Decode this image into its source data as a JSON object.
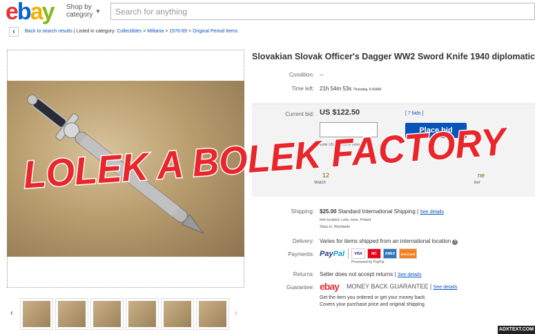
{
  "header": {
    "logo": {
      "e": "e",
      "b": "b",
      "a": "a",
      "y": "y"
    },
    "shop_by": "Shop by",
    "category": "category",
    "search_placeholder": "Search for anything"
  },
  "breadcrumb": {
    "back": "Back to search results",
    "listed": "| Listed in category:",
    "items": [
      "Collectibles",
      "Militaria",
      "1976-89",
      "Original Period Items"
    ],
    "sep": ">"
  },
  "listing": {
    "title": "Slovakian Slovak Officer's Dagger WW2 Sword Knife 1940 diplomatic",
    "condition_label": "Condition:",
    "condition_value": "--",
    "time_left_label": "Time left:",
    "time_left_value": "21h 54m 53s",
    "time_left_date": "Thursday, 6:43AM",
    "current_bid_label": "Current bid:",
    "current_bid_value": "US $122.50",
    "bids": "[ 7 bids ]",
    "place_bid": "Place bid",
    "bid_hint": "Enter US $125.00 or more",
    "hidden_left": "12",
    "hidden_watch": "Watch",
    "hidden_right": "ne",
    "hidden_ber": "ber",
    "shipping_label": "Shipping:",
    "shipping_price": "$25.00",
    "shipping_method": "Standard International Shipping |",
    "see_details": "See details",
    "item_location": "Item location:  Lodz, none, Poland",
    "ships_to": "Ships to:  Worldwide",
    "delivery_label": "Delivery:",
    "delivery_value": "Varies for items shipped from an international location",
    "payments_label": "Payments:",
    "paypal_a": "Pay",
    "paypal_b": "Pal",
    "processed": "Processed by PayPal",
    "cards": [
      "VISA",
      "MC",
      "AMEX",
      "DISCOVER"
    ],
    "returns_label": "Returns:",
    "returns_value": "Seller does not accept returns |",
    "guarantee_label": "Guarantee:",
    "guarantee_brand": "ebay",
    "guarantee_text": "MONEY BACK GUARANTEE |",
    "guarantee_line1": "Get the item you ordered or get your money back.",
    "guarantee_line2": "Covers your purchase price and original shipping."
  },
  "watermark": "LOLEK A BOLEK FACTORY",
  "badge": "ADXTEXT.COM",
  "colors": {
    "accent": "#0654ba",
    "watermark": "#e8262b"
  }
}
